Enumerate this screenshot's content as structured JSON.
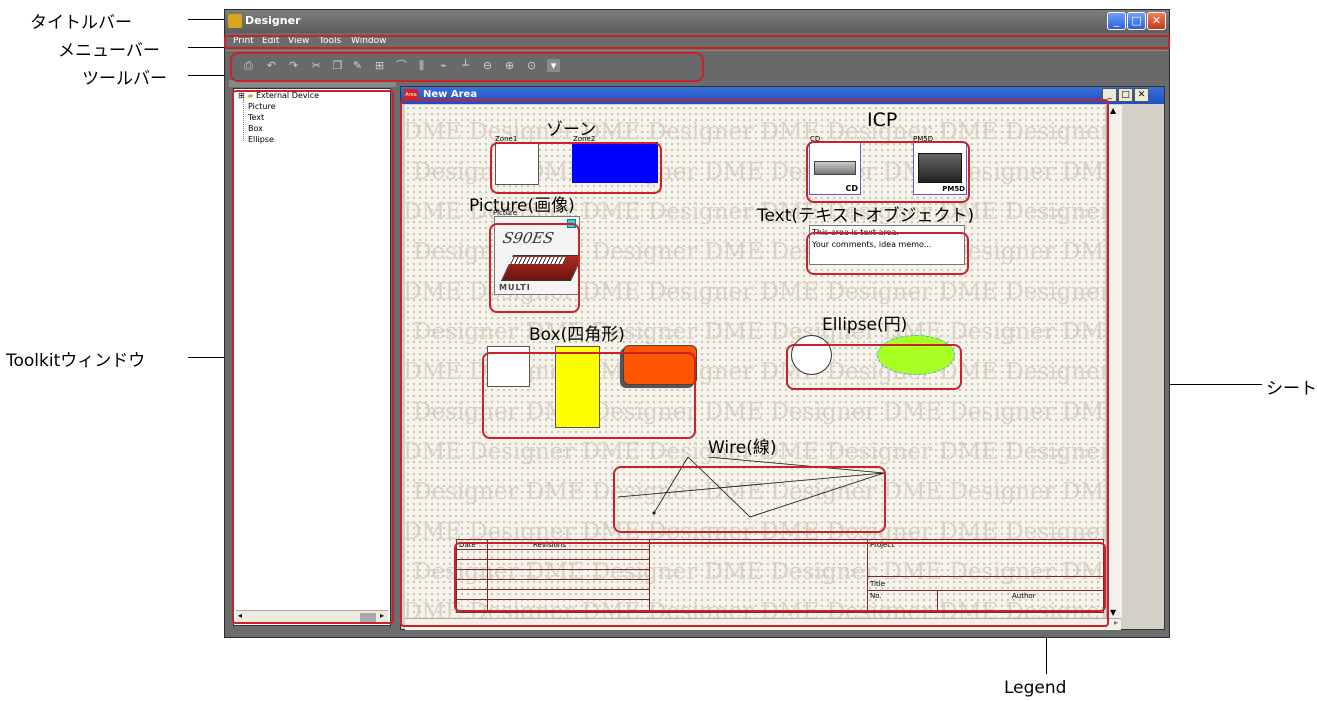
{
  "callouts": {
    "title_bar": "タイトルバー",
    "menu_bar": "メニューバー",
    "toolbar": "ツールバー",
    "toolkit_window": "Toolkitウィンドウ",
    "sheet": "シート",
    "legend": "Legend"
  },
  "app": {
    "title": "Designer",
    "menus": [
      "Print",
      "Edit",
      "View",
      "Tools",
      "Window"
    ]
  },
  "toolkit": {
    "tree": [
      "External Device",
      "Picture",
      "Text",
      "Box",
      "Ellipse"
    ]
  },
  "sheet_window": {
    "title": "New Area",
    "icon_label": "Area"
  },
  "watermark": "DME Designer",
  "sheet": {
    "zone": {
      "label": "ゾーン",
      "zone1": "Zone1",
      "zone2": "Zone2"
    },
    "icp": {
      "label": "ICP",
      "cd": "CD",
      "pm5d": "PM5D"
    },
    "picture": {
      "label": "Picture(画像)",
      "caption": "Picture",
      "brand": "S90ES",
      "mode": "MULTI"
    },
    "text": {
      "label": "Text(テキストオブジェクト)",
      "line1": "This area is text area.",
      "line2": "Your comments, idea memo..."
    },
    "box": {
      "label": "Box(四角形)"
    },
    "ellipse": {
      "label": "Ellipse(円)"
    },
    "wire": {
      "label": "Wire(線)"
    },
    "legend": {
      "date": "Date",
      "revisions": "Revisions",
      "project": "Project",
      "title": "Title",
      "no": "No.",
      "author": "Author"
    }
  },
  "colors": {
    "callout_red": "#c8232c",
    "zone2_fill": "#0000ff",
    "box_yellow": "#ffff00",
    "box_orange": "#ff5500",
    "ellipse_green": "#aaff22"
  }
}
